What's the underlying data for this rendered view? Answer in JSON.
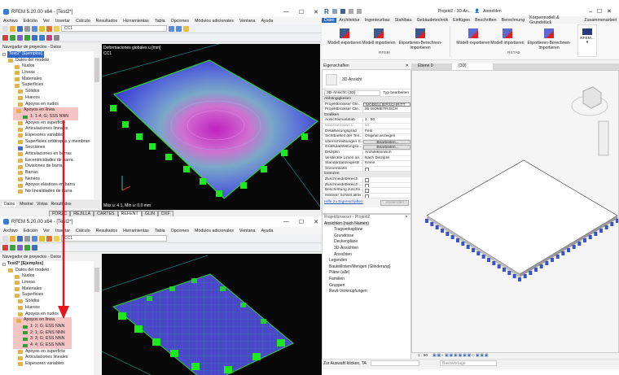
{
  "rfem_top": {
    "title": "RFEM 5.20.00 x64 - [Test2*]",
    "menu": [
      "Archivo",
      "Edición",
      "Ver",
      "Insertar",
      "Cálculo",
      "Resultados",
      "Herramientas",
      "Tabla",
      "Opciones",
      "Módulos adicionales",
      "Ventana",
      "Ayuda"
    ],
    "load_case": "CC1",
    "navigator_title": "Navegador de proyectos - Datos",
    "tree": {
      "root": "Test2* [Ejemplos]",
      "model": "Datos del modelo",
      "items_a": [
        "Nudos",
        "Líneas",
        "Materiales",
        "Superficies",
        "Sólidos",
        "Huecos",
        "Apoyos en nudos"
      ],
      "line_supports": "Apoyos en línea",
      "supports": [
        "1: 1-4; G; SSS NNN"
      ],
      "items_b": [
        "Apoyos en superficie",
        "Articulaciones lineales",
        "Espesores variables",
        "Superficies ortótropas y membran",
        "Secciones",
        "Articulaciones en barras",
        "Excentricidades de barra",
        "Divisiones de barra",
        "Barras",
        "Nervios",
        "Apoyos elásticos en barra",
        "No linealidades de barra"
      ]
    },
    "nav_tabs": [
      "Datos",
      "Mostrar",
      "Vistas",
      "Resultados"
    ],
    "viewport_label": "Deformaciones globales u [mm]",
    "viewport_case": "CC1",
    "viewport_footer": "Máx u: 4.1, Mín u: 0.0 mm",
    "status_tabs": [
      "FORZC",
      "REJILLA",
      "CARTES",
      "REFENT",
      "GLIN",
      "DXF"
    ]
  },
  "rfem_bottom": {
    "title": "RFEM 5.20.00 x64 - [Test2*]",
    "load_case": "CC1",
    "navigator_title": "Navegador de proyectos - Datos",
    "tree": {
      "root": "Test2* [Ejemplos]",
      "model": "Datos del modelo",
      "items_a": [
        "Nudos",
        "Líneas",
        "Materiales",
        "Superficies",
        "Sólidos",
        "Huecos",
        "Apoyos en nudos"
      ],
      "line_supports": "Apoyos en línea",
      "supports": [
        "1: 2; G; ESS NNN",
        "2: 1; G; ENS NNN",
        "3: 3; G; ESS NNN",
        "4: 4; G; ESS NNN"
      ],
      "items_b": [
        "Apoyos en superficie",
        "Articulaciones lineales",
        "Espesores variables"
      ]
    }
  },
  "revit": {
    "title": "Projekt2 - 3D-An...",
    "signin": "Anmelden",
    "tabs": [
      "Datei",
      "Architektur",
      "Ingenieurbau",
      "Stahlbau",
      "Gebäudetechnik",
      "Einfügen",
      "Beschriften",
      "Berechnung",
      "Körpermodell & Grundstück",
      "Zusammenarbeit"
    ],
    "ribbon_rfem": [
      "Modell exportieren",
      "Modell importieren",
      "Exportieren-Berechnen-Importieren"
    ],
    "ribbon_rstab": [
      "Modell exportieren",
      "Modell importieren",
      "Exportieren-Berechnen-Importieren"
    ],
    "panel_rfem": "RFEM",
    "panel_rstab": "RSTAB",
    "rfem_btn": "RFEM...",
    "properties_title": "Eigenschaften",
    "type_name": "3D-Ansicht",
    "view_select": "3D-Ansicht: {3D}",
    "edit_type": "Typ bearbeiten",
    "sections": [
      "Abhängigkeiten",
      "Grafiken",
      "Grenzen"
    ],
    "props_dep": [
      [
        "Projektbrowser Gle...",
        "MODELLIERSCHRITT"
      ],
      [
        "Projektbrowser Gle...",
        "00 ISOMETRISCH"
      ]
    ],
    "props_graph": [
      [
        "Ansichtsmaßstab",
        "1 : 50"
      ],
      [
        "Maßstabswert 1:",
        "50"
      ],
      [
        "Detaillierungsgrad",
        "Fein"
      ],
      [
        "Sichtbarkeit der Teil...",
        "Original anzeigen"
      ],
      [
        "Überschreibungen S...",
        "Bearbeiten..."
      ],
      [
        "Grafikdarstellungso...",
        "Bearbeiten..."
      ],
      [
        "Disziplin",
        "Architektonisch"
      ],
      [
        "Verdeckte Linien an...",
        "Nach Disziplin"
      ],
      [
        "Standardanzeigestil ...",
        "Keine"
      ],
      [
        "Sonnenbahn",
        ""
      ]
    ],
    "props_bounds": [
      [
        "Zuschneidebereich",
        ""
      ],
      [
        "Zuschneidebereich ...",
        ""
      ],
      [
        "Beschriftung zuschn...",
        ""
      ],
      [
        "Hinterer Schnitt aktiv",
        ""
      ]
    ],
    "help_link": "Hilfe zu Eigenschaften",
    "apply": "Anwenden",
    "browser_title": "Projektbrowser - Projekt2",
    "browser": {
      "views": "Ansichten (nach Namen)",
      "sub": [
        "Tragwerkspläne",
        "Grundrisse",
        "Deckenpläne",
        "3D-Ansichten",
        "Ansichten"
      ],
      "top": [
        "Legenden",
        "Bauteillisten/Mengen (Gliederung)",
        "Pläne (alle)",
        "Familien",
        "Gruppen",
        "Revit-Verknüpfungen"
      ]
    },
    "view_tabs": [
      "Ebene 0",
      "{3D}"
    ],
    "scale": "1 : 50",
    "status": "Zur Auswahl klicken, TA",
    "base_template": "Basisvorlage"
  },
  "colors": {
    "highlight": "#f6c4c4",
    "arrow": "#e8141c",
    "support": "#1ee81e",
    "revit_support": "#3b53c9"
  }
}
